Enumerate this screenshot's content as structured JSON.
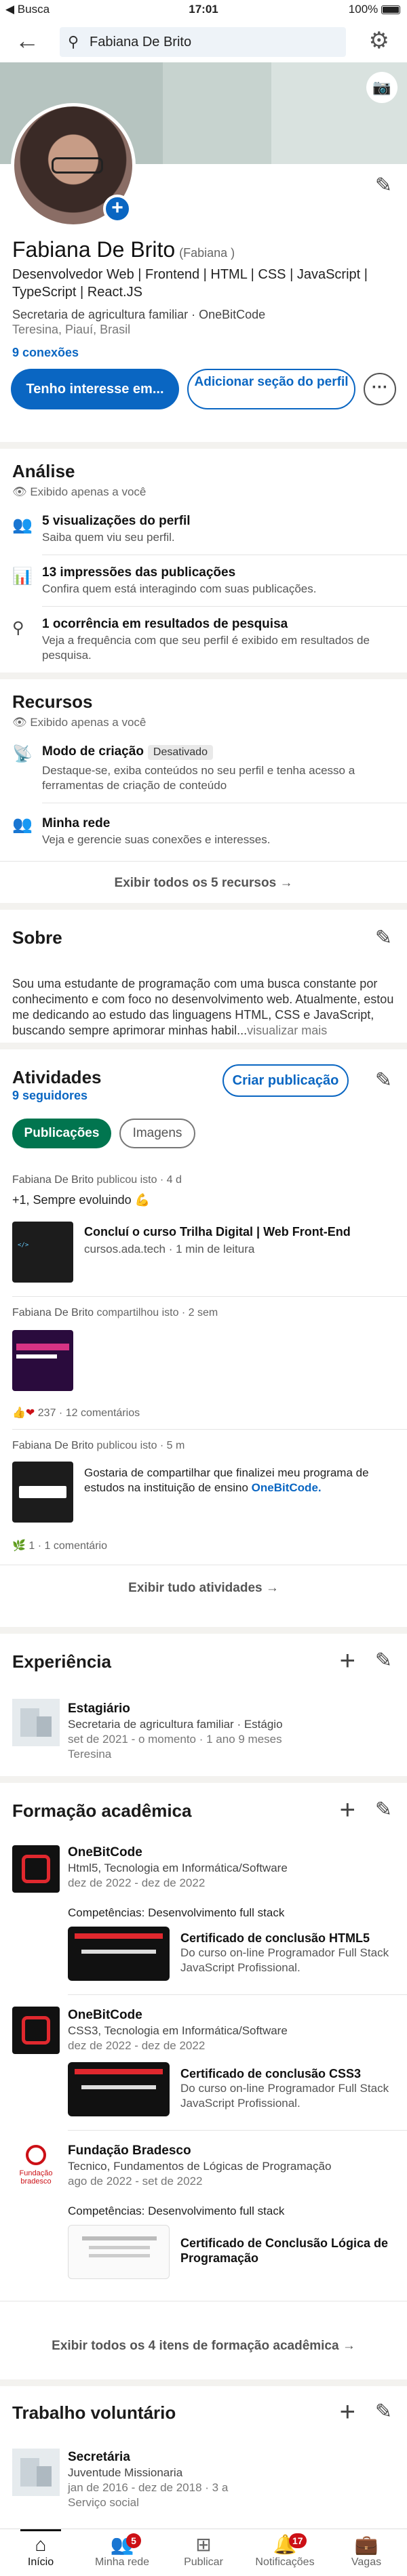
{
  "status_bar": {
    "carrier": "◀ Busca",
    "time": "17:01",
    "battery": "100%"
  },
  "search": {
    "value": "Fabiana De Brito"
  },
  "profile": {
    "name": "Fabiana De Brito",
    "pronouns": "(Fabiana )",
    "headline": "Desenvolvedor Web | Frontend | HTML | CSS | JavaScript | TypeScript | React.JS",
    "work": "Secretaria de agricultura familiar · OneBitCode",
    "location": "Teresina, Piauí, Brasil",
    "connections": "9 conexões",
    "btn_interest": "Tenho interesse em...",
    "btn_add_section": "Adicionar seção do perfil",
    "btn_more": "···"
  },
  "analytics": {
    "title": "Análise",
    "private": "Exibido apenas a você",
    "items": [
      {
        "title": "5 visualizações do perfil",
        "sub": "Saiba quem viu seu perfil."
      },
      {
        "title": "13 impressões das publicações",
        "sub": "Confira quem está interagindo com suas publicações."
      },
      {
        "title": "1 ocorrência em resultados de pesquisa",
        "sub": "Veja a frequência com que seu perfil é exibido em resultados de pesquisa."
      }
    ]
  },
  "resources": {
    "title": "Recursos",
    "private": "Exibido apenas a você",
    "items": [
      {
        "title": "Modo de criação",
        "badge": "Desativado",
        "sub": "Destaque-se, exiba conteúdos no seu perfil e tenha acesso a ferramentas de criação de conteúdo"
      },
      {
        "title": "Minha rede",
        "sub": "Veja e gerencie suas conexões e interesses."
      }
    ],
    "show_all": "Exibir todos os 5 recursos →"
  },
  "about": {
    "title": "Sobre",
    "text": "Sou uma estudante de programação com uma busca constante por conhecimento e com foco no desenvolvimento web. Atualmente, estou me dedicando ao estudo das linguagens HTML, CSS e JavaScript, buscando sempre aprimorar minhas habil...",
    "see_more": "visualizar mais"
  },
  "activity": {
    "title": "Atividades",
    "followers": "9 seguidores",
    "create_post": "Criar publicação",
    "tab_posts": "Publicações",
    "tab_images": "Imagens",
    "posts": [
      {
        "author": "Fabiana De Brito",
        "meta": "publicou isto · 4 d",
        "text": "+1, Sempre evoluindo 💪",
        "title": "Concluí o curso Trilha Digital | Web Front-End",
        "desc": "cursos.ada.tech · 1 min de leitura"
      },
      {
        "author": "Fabiana De Brito",
        "meta": "compartilhou isto · 2 sem",
        "reactions": "237 · 12 comentários"
      },
      {
        "author": "Fabiana De Brito",
        "meta": "publicou isto · 5 m",
        "desc": "Gostaria de compartilhar que finalizei meu programa de estudos na instituição de ensino ",
        "desc_link": "OneBitCode.",
        "reactions": "1 · 1 comentário"
      }
    ],
    "show_all": "Exibir tudo atividades →"
  },
  "experience": {
    "title": "Experiência",
    "items": [
      {
        "title": "Estagiário",
        "company": "Secretaria de agricultura familiar · Estágio",
        "dates": "set de 2021 - o momento · 1 ano 9 meses",
        "location": "Teresina"
      }
    ]
  },
  "education": {
    "title": "Formação acadêmica",
    "items": [
      {
        "school": "OneBitCode",
        "degree": "Html5, Tecnologia em Informática/Software",
        "dates": "dez de 2022 - dez de 2022",
        "skills": "Competências: Desenvolvimento full stack",
        "cert_title": "Certificado de conclusão HTML5",
        "cert_desc": "Do curso on-line Programador Full Stack JavaScript Profissional."
      },
      {
        "school": "OneBitCode",
        "degree": "CSS3, Tecnologia em Informática/Software",
        "dates": "dez de 2022 - dez de 2022",
        "cert_title": "Certificado de conclusão CSS3",
        "cert_desc": "Do curso on-line Programador Full Stack JavaScript Profissional."
      },
      {
        "school": "Fundação Bradesco",
        "logo_text": "Fundação bradesco",
        "degree": "Tecnico, Fundamentos de Lógicas de Programação",
        "dates": "ago de 2022 - set de 2022",
        "skills": "Competências: Desenvolvimento full stack",
        "cert_title": "Certificado de Conclusão Lógica de Programação"
      }
    ],
    "show_all": "Exibir todos os 4 itens de formação acadêmica →"
  },
  "volunteer": {
    "title": "Trabalho voluntário",
    "items": [
      {
        "title": "Secretária",
        "org": "Juventude Missionaria",
        "dates": "jan de 2016 - dez de 2018 · 3 a",
        "cause": "Serviço social"
      }
    ]
  },
  "bottom_nav": {
    "items": [
      {
        "label": "Início"
      },
      {
        "label": "Minha rede",
        "badge": "5"
      },
      {
        "label": "Publicar"
      },
      {
        "label": "Notificações",
        "badge": "17"
      },
      {
        "label": "Vagas"
      }
    ]
  },
  "colors": {
    "primary": "#0a66c2",
    "green": "#01754f",
    "badge_red": "#cc1016"
  }
}
